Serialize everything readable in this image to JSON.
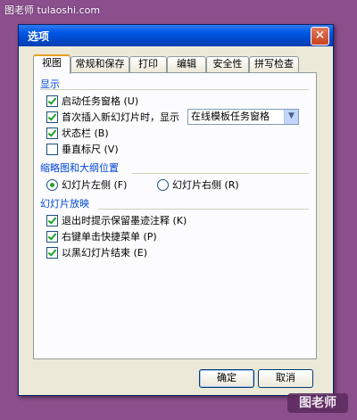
{
  "watermark": {
    "top_text": "图老师 tulaoshi.com",
    "bottom_text": "图老师"
  },
  "dialog": {
    "title": "选项",
    "close_glyph": "✕",
    "tabs": [
      {
        "label": "视图",
        "active": true
      },
      {
        "label": "常规和保存",
        "active": false
      },
      {
        "label": "打印",
        "active": false
      },
      {
        "label": "编辑",
        "active": false
      },
      {
        "label": "安全性",
        "active": false
      },
      {
        "label": "拼写检查",
        "active": false
      }
    ],
    "groups": {
      "display": {
        "title": "显示",
        "items": [
          {
            "label": "启动任务窗格 (U)",
            "checked": true
          },
          {
            "label": "首次插入新幻灯片时，显示",
            "checked": true
          },
          {
            "label": "状态栏 (B)",
            "checked": true
          },
          {
            "label": "垂直标尺 (V)",
            "checked": false
          }
        ],
        "dropdown_value": "在线模板任务窗格"
      },
      "thumbnail": {
        "title": "缩略图和大纲位置",
        "options": [
          {
            "label": "幻灯片左侧 (F)",
            "selected": true
          },
          {
            "label": "幻灯片右侧 (R)",
            "selected": false
          }
        ]
      },
      "slideshow": {
        "title": "幻灯片放映",
        "items": [
          {
            "label": "退出时提示保留墨迹注释 (K)",
            "checked": true
          },
          {
            "label": "右键单击快捷菜单 (P)",
            "checked": true
          },
          {
            "label": "以黑幻灯片结束 (E)",
            "checked": true
          }
        ]
      }
    },
    "buttons": {
      "ok": "确定",
      "cancel": "取消"
    }
  }
}
